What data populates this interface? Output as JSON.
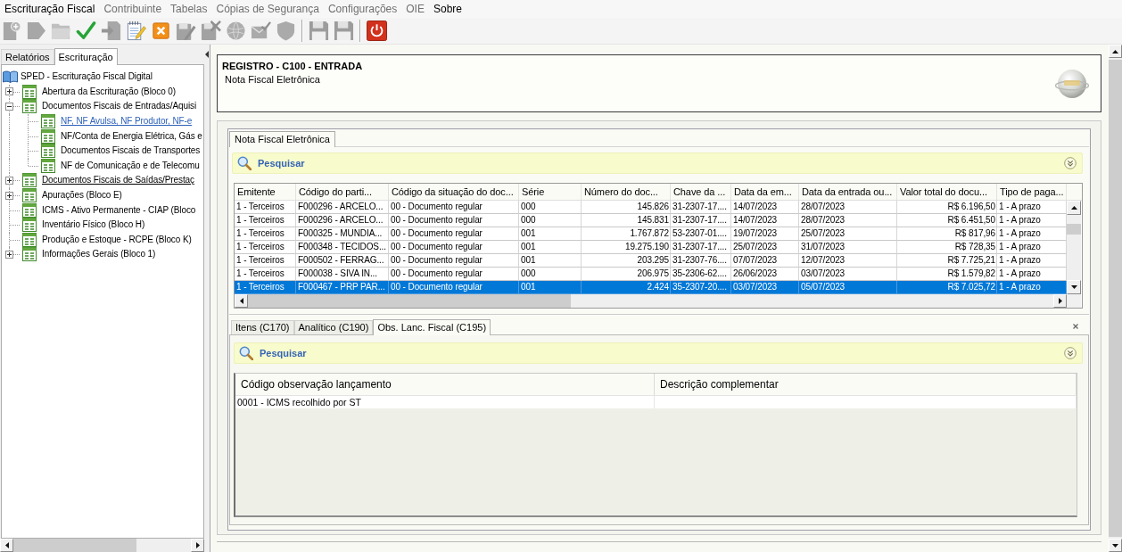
{
  "menu": [
    {
      "label": "Escrituração Fiscal",
      "disabled": false
    },
    {
      "label": "Contribuinte",
      "disabled": true
    },
    {
      "label": "Tabelas",
      "disabled": true
    },
    {
      "label": "Cópias de Segurança",
      "disabled": true
    },
    {
      "label": "Configurações",
      "disabled": true
    },
    {
      "label": "OIE",
      "disabled": true
    },
    {
      "label": "Sobre",
      "disabled": false
    }
  ],
  "toolbar": [
    {
      "kind": "new_document",
      "disabled": true
    },
    {
      "kind": "forward",
      "disabled": true
    },
    {
      "kind": "folder",
      "disabled": true
    },
    {
      "kind": "confirm",
      "disabled": false
    },
    {
      "kind": "import",
      "disabled": true
    },
    {
      "kind": "notepad",
      "disabled": false
    },
    {
      "kind": "cancel",
      "disabled": false
    },
    {
      "kind": "sign",
      "disabled": true
    },
    {
      "kind": "sign_remove",
      "disabled": true
    },
    {
      "kind": "globe",
      "disabled": true
    },
    {
      "kind": "envelope",
      "disabled": true
    },
    {
      "kind": "shield",
      "disabled": true
    },
    {
      "kind": "separator"
    },
    {
      "kind": "save",
      "disabled": true
    },
    {
      "kind": "save",
      "disabled": true
    },
    {
      "kind": "separator"
    },
    {
      "kind": "power",
      "disabled": false
    }
  ],
  "left_panel": {
    "tabs": [
      {
        "label": "Relatórios",
        "selected": false
      },
      {
        "label": "Escrituração",
        "selected": true
      }
    ],
    "tree": [
      {
        "kind": "root",
        "label": "SPED - Escrituração Fiscal Digital",
        "selected": false,
        "hovered": false,
        "children": [
          {
            "kind": "group",
            "label": "Abertura da Escrituração (Bloco 0)",
            "expanded": false,
            "selected": false,
            "hovered": false
          },
          {
            "kind": "group",
            "label": "Documentos Fiscais de Entradas/Aquisi",
            "expanded": true,
            "selected": false,
            "hovered": false,
            "children": [
              {
                "kind": "leaf",
                "label": "NF, NF Avulsa, NF Produtor, NF-e",
                "selected": true,
                "hovered": false
              },
              {
                "kind": "leaf",
                "label": "NF/Conta de Energia Elétrica, Gás e",
                "selected": false,
                "hovered": false
              },
              {
                "kind": "leaf",
                "label": "Documentos Fiscais de Transportes",
                "selected": false,
                "hovered": false
              },
              {
                "kind": "leaf",
                "label": "NF de Comunicação e de Telecomu",
                "selected": false,
                "hovered": false
              }
            ]
          },
          {
            "kind": "group",
            "label": "Documentos Fiscais de Saídas/Prestaç",
            "expanded": false,
            "selected": false,
            "hovered": true
          },
          {
            "kind": "group",
            "label": "Apurações (Bloco E)",
            "expanded": false,
            "selected": false,
            "hovered": false
          },
          {
            "kind": "leaf",
            "label": "ICMS - Ativo Permanente - CIAP (Bloco",
            "selected": false,
            "hovered": false
          },
          {
            "kind": "leaf",
            "label": "Inventário Físico (Bloco H)",
            "selected": false,
            "hovered": false
          },
          {
            "kind": "leaf",
            "label": "Produção e Estoque - RCPE (Bloco K)",
            "selected": false,
            "hovered": false
          },
          {
            "kind": "group",
            "label": "Informações Gerais (Bloco 1)",
            "expanded": false,
            "selected": false,
            "hovered": false
          }
        ]
      }
    ]
  },
  "record_header": {
    "title": "REGISTRO - C100 - ENTRADA",
    "subtitle": "Nota Fiscal Eletrônica"
  },
  "record_tabs": [
    {
      "label": "Nota Fiscal Eletrônica",
      "selected": true
    }
  ],
  "search_bar": {
    "label": "Pesquisar"
  },
  "documents_table": {
    "columns": [
      {
        "label": "Emitente"
      },
      {
        "label": "Código do parti..."
      },
      {
        "label": "Código da situação do doc..."
      },
      {
        "label": "Série"
      },
      {
        "label": "Número do doc..."
      },
      {
        "label": "Chave da ..."
      },
      {
        "label": "Data da em..."
      },
      {
        "label": "Data da entrada ou..."
      },
      {
        "label": "Valor total do docu..."
      },
      {
        "label": "Tipo de paga..."
      }
    ],
    "rows": [
      {
        "selected": false,
        "cells": [
          "1 - Terceiros",
          "F000296 - ARCELO...",
          "00 - Documento regular",
          "000",
          "145.826",
          "31-2307-17....",
          "14/07/2023",
          "28/07/2023",
          "R$ 6.196,50",
          "1 - A prazo"
        ]
      },
      {
        "selected": false,
        "cells": [
          "1 - Terceiros",
          "F000296 - ARCELO...",
          "00 - Documento regular",
          "000",
          "145.831",
          "31-2307-17....",
          "14/07/2023",
          "28/07/2023",
          "R$ 6.451,50",
          "1 - A prazo"
        ]
      },
      {
        "selected": false,
        "cells": [
          "1 - Terceiros",
          "F000325 - MUNDIA...",
          "00 - Documento regular",
          "001",
          "1.767.872",
          "53-2307-01....",
          "19/07/2023",
          "25/07/2023",
          "R$ 817,96",
          "1 - A prazo"
        ]
      },
      {
        "selected": false,
        "cells": [
          "1 - Terceiros",
          "F000348 - TECIDOS...",
          "00 - Documento regular",
          "001",
          "19.275.190",
          "31-2307-17....",
          "25/07/2023",
          "31/07/2023",
          "R$ 728,35",
          "1 - A prazo"
        ]
      },
      {
        "selected": false,
        "cells": [
          "1 - Terceiros",
          "F000502 - FERRAG...",
          "00 - Documento regular",
          "001",
          "203.295",
          "31-2307-76....",
          "07/07/2023",
          "12/07/2023",
          "R$ 7.725,21",
          "1 - A prazo"
        ]
      },
      {
        "selected": false,
        "cells": [
          "1 - Terceiros",
          "F000038 - SIVA IN...",
          "00 - Documento regular",
          "000",
          "206.975",
          "35-2306-62....",
          "26/06/2023",
          "03/07/2023",
          "R$ 1.579,82",
          "1 - A prazo"
        ]
      },
      {
        "selected": true,
        "cells": [
          "1 - Terceiros",
          "F000467 - PRP PAR...",
          "00 - Documento regular",
          "001",
          "2.424",
          "35-2307-20....",
          "03/07/2023",
          "05/07/2023",
          "R$ 7.025,72",
          "1 - A prazo"
        ]
      }
    ]
  },
  "detail_tabs": [
    {
      "label": "Itens (C170)",
      "selected": false
    },
    {
      "label": "Analítico (C190)",
      "selected": false
    },
    {
      "label": "Obs. Lanc. Fiscal (C195)",
      "selected": true
    }
  ],
  "detail_search_bar": {
    "label": "Pesquisar"
  },
  "observations_table": {
    "columns": [
      {
        "label": "Código observação lançamento"
      },
      {
        "label": "Descrição complementar"
      }
    ],
    "rows": [
      {
        "selected": false,
        "cells": [
          "0001 - ICMS recolhido por ST"
        ]
      }
    ]
  }
}
